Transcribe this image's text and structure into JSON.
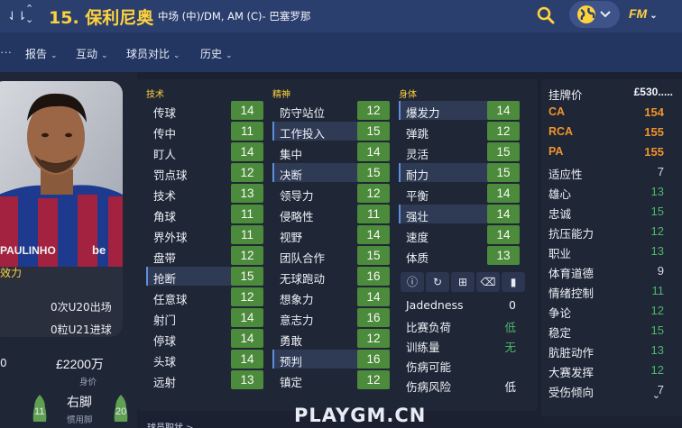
{
  "header": {
    "title": "15. 保利尼奥",
    "subtitle": "中场 (中)/DM, AM (C)- 巴塞罗那",
    "brand": "FM"
  },
  "subnav": {
    "items": [
      {
        "label": "报告"
      },
      {
        "label": "互动"
      },
      {
        "label": "球员对比"
      },
      {
        "label": "历史"
      }
    ]
  },
  "profile": {
    "shirt_name": "PAULINHO",
    "role_text": "效力",
    "u20_apps": "0次U20出场",
    "u21_goals": "0粒U21进球",
    "left_edge_value": "0",
    "value": "£2200万",
    "value_label": "身价",
    "preferred_foot": "右脚",
    "preferred_foot_label": "惯用脚",
    "left_foot_rating": "11",
    "right_foot_rating": "20"
  },
  "attributes": {
    "technical": {
      "heading": "技术",
      "items": [
        {
          "label": "传球",
          "value": "14"
        },
        {
          "label": "传中",
          "value": "11"
        },
        {
          "label": "盯人",
          "value": "14"
        },
        {
          "label": "罚点球",
          "value": "12"
        },
        {
          "label": "技术",
          "value": "13"
        },
        {
          "label": "角球",
          "value": "11"
        },
        {
          "label": "界外球",
          "value": "11"
        },
        {
          "label": "盘带",
          "value": "12"
        },
        {
          "label": "抢断",
          "value": "15"
        },
        {
          "label": "任意球",
          "value": "12"
        },
        {
          "label": "射门",
          "value": "14"
        },
        {
          "label": "停球",
          "value": "14"
        },
        {
          "label": "头球",
          "value": "14"
        },
        {
          "label": "远射",
          "value": "13"
        }
      ]
    },
    "mental": {
      "heading": "精神",
      "items": [
        {
          "label": "防守站位",
          "value": "12"
        },
        {
          "label": "工作投入",
          "value": "15"
        },
        {
          "label": "集中",
          "value": "14"
        },
        {
          "label": "决断",
          "value": "15"
        },
        {
          "label": "领导力",
          "value": "12"
        },
        {
          "label": "侵略性",
          "value": "11"
        },
        {
          "label": "视野",
          "value": "14"
        },
        {
          "label": "团队合作",
          "value": "15"
        },
        {
          "label": "无球跑动",
          "value": "16"
        },
        {
          "label": "想象力",
          "value": "14"
        },
        {
          "label": "意志力",
          "value": "16"
        },
        {
          "label": "勇敢",
          "value": "12"
        },
        {
          "label": "预判",
          "value": "16"
        },
        {
          "label": "镇定",
          "value": "12"
        }
      ]
    },
    "physical": {
      "heading": "身体",
      "items": [
        {
          "label": "爆发力",
          "value": "14"
        },
        {
          "label": "弹跳",
          "value": "12"
        },
        {
          "label": "灵活",
          "value": "15"
        },
        {
          "label": "耐力",
          "value": "15"
        },
        {
          "label": "平衡",
          "value": "14"
        },
        {
          "label": "强壮",
          "value": "14"
        },
        {
          "label": "速度",
          "value": "14"
        },
        {
          "label": "体质",
          "value": "13"
        }
      ]
    }
  },
  "hidden": [
    {
      "label": "Jadedness",
      "value": "0"
    },
    {
      "label": "比赛负荷",
      "value": "低"
    },
    {
      "label": "训练量",
      "value": "无"
    },
    {
      "label": "伤病可能",
      "value": ""
    },
    {
      "label": "伤病风险",
      "value": "低"
    }
  ],
  "right": [
    {
      "label": "挂牌价",
      "value": "£530....."
    },
    {
      "label": "CA",
      "value": "154"
    },
    {
      "label": "RCA",
      "value": "155"
    },
    {
      "label": "PA",
      "value": "155"
    },
    {
      "label": "适应性",
      "value": "7"
    },
    {
      "label": "雄心",
      "value": "13"
    },
    {
      "label": "忠诚",
      "value": "15"
    },
    {
      "label": "抗压能力",
      "value": "12"
    },
    {
      "label": "职业",
      "value": "13"
    },
    {
      "label": "体育道德",
      "value": "9"
    },
    {
      "label": "情绪控制",
      "value": "11"
    },
    {
      "label": "争论",
      "value": "12"
    },
    {
      "label": "稳定",
      "value": "15"
    },
    {
      "label": "肮脏动作",
      "value": "13"
    },
    {
      "label": "大赛发挥",
      "value": "12"
    },
    {
      "label": "受伤倾向",
      "value": "7"
    }
  ],
  "bottom": {
    "link": "球员职状 >",
    "watermark": "PLAYGM.CN"
  },
  "colors": {
    "header_bg": "#2b3f6e",
    "title": "#ffd23d",
    "attr_green": "#4c8a3c",
    "orange": "#f0932b",
    "positive_green": "#4db86a"
  }
}
